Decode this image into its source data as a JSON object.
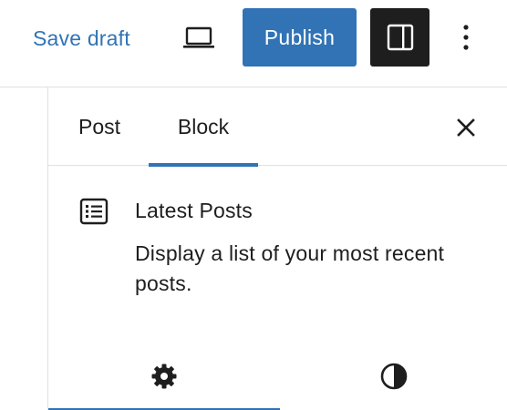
{
  "toolbar": {
    "save_draft_label": "Save draft",
    "preview_icon": "laptop-icon",
    "publish_label": "Publish",
    "settings_icon": "sidebar-panel-icon",
    "options_icon": "vertical-ellipsis-icon"
  },
  "sidebar": {
    "tabs": [
      {
        "label": "Post",
        "active": false
      },
      {
        "label": "Block",
        "active": true
      }
    ],
    "close_icon": "close-icon",
    "block": {
      "icon": "post-list-icon",
      "title": "Latest Posts",
      "description": "Display a list of your most recent posts."
    },
    "inspector_tabs": [
      {
        "icon": "gear-icon",
        "active": true
      },
      {
        "icon": "half-circle-contrast-icon",
        "active": false
      }
    ]
  },
  "colors": {
    "accent": "#3173b5",
    "dark": "#1e1e1e",
    "border": "#e0e0e0"
  }
}
